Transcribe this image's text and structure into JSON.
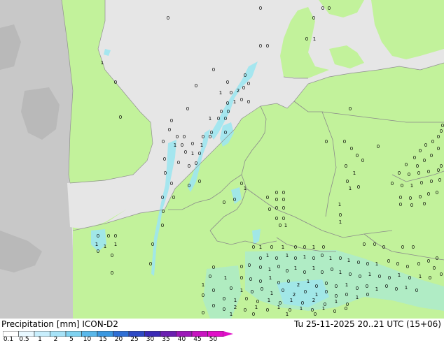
{
  "map": {
    "colors": {
      "sea": "#e6e6e6",
      "land_outside": "#c8c8c8",
      "precip_area": "#c2f29b",
      "light_precip": "#9de6f0",
      "border": "#8a8a8a"
    },
    "cell_labels": [
      "0",
      "1",
      "2"
    ]
  },
  "footer": {
    "title": "Precipitation [mm]  ICON-D2",
    "datetime": "Tu 25-11-2025 20..21 UTC (15+06)",
    "legend": {
      "ticks": [
        "0.1",
        "0.5",
        "1",
        "2",
        "5",
        "10",
        "15",
        "20",
        "25",
        "30",
        "35",
        "40",
        "45",
        "50"
      ],
      "colors": [
        "#ffffff",
        "#e8f8ff",
        "#c8eefc",
        "#a6e2f7",
        "#7fd2f0",
        "#5ab8ea",
        "#3b98e0",
        "#2f6fd4",
        "#2e4ac4",
        "#3a2ab5",
        "#6b1fb0",
        "#9c18b8",
        "#c814c0",
        "#e010c8"
      ]
    }
  }
}
